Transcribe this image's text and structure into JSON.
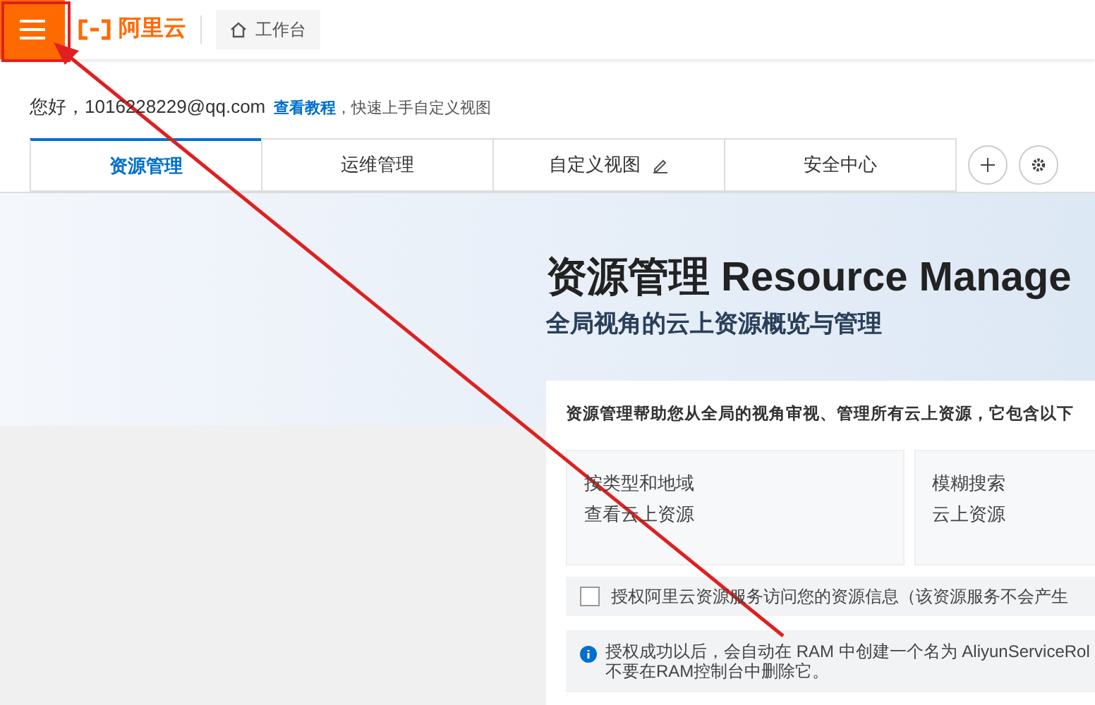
{
  "header": {
    "brand": "阿里云",
    "workbench": "工作台"
  },
  "greeting": {
    "text": "您好，1016228229@qq.com",
    "link": "查看教程",
    "hint": "，快速上手自定义视图"
  },
  "tabs": [
    {
      "label": "资源管理",
      "selected": true,
      "editable": false
    },
    {
      "label": "运维管理",
      "selected": false,
      "editable": false
    },
    {
      "label": "自定义视图",
      "selected": false,
      "editable": true
    },
    {
      "label": "安全中心",
      "selected": false,
      "editable": false
    }
  ],
  "banner": {
    "title": "资源管理 Resource Manage",
    "subtitle": "全局视角的云上资源概览与管理"
  },
  "card": {
    "intro": "资源管理帮助您从全局的视角审视、管理所有云上资源，它包含以下",
    "features": [
      {
        "line1": "按类型和地域",
        "line2": "查看云上资源"
      },
      {
        "line1": "模糊搜索",
        "line2": "云上资源"
      }
    ],
    "consent": {
      "label": "授权阿里云资源服务访问您的资源信息（该资源服务不会产生",
      "checked": false
    },
    "info": [
      "授权成功以后，会自动在 RAM 中创建一个名为 AliyunServiceRol",
      "不要在RAM控制台中删除它。"
    ]
  }
}
